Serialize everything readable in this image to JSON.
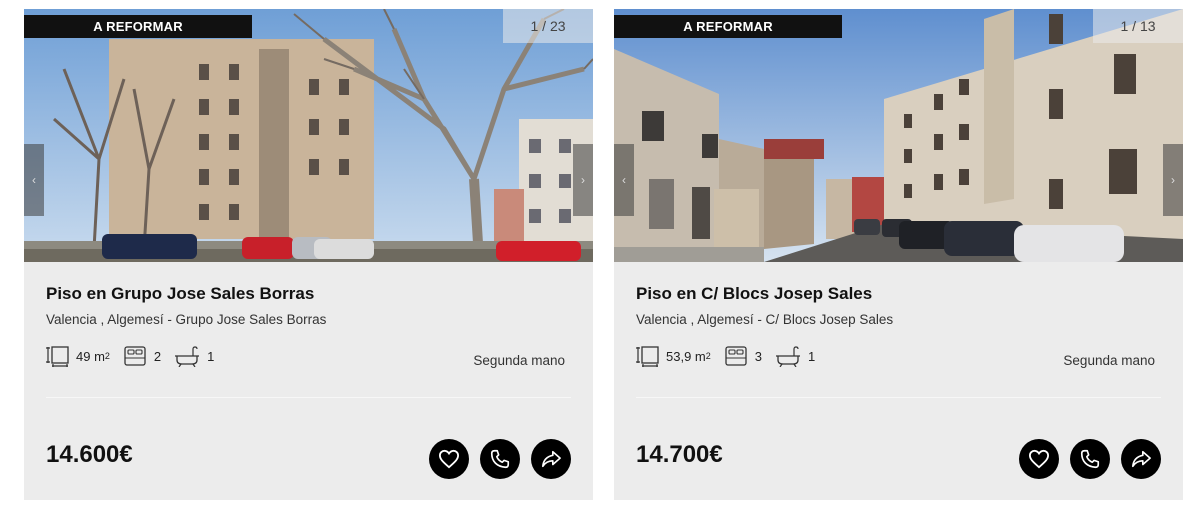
{
  "listings": [
    {
      "badge": "A REFORMAR",
      "photo_counter": "1 / 23",
      "title": "Piso en Grupo Jose Sales Borras",
      "location": "Valencia , Algemesí - Grupo Jose Sales Borras",
      "area_value": "49 m",
      "area_sup": "2",
      "bedrooms": "2",
      "bathrooms": "1",
      "condition": "Segunda mano",
      "price": "14.600€"
    },
    {
      "badge": "A REFORMAR",
      "photo_counter": "1 / 13",
      "title": "Piso en C/ Blocs Josep Sales",
      "location": "Valencia , Algemesí - C/ Blocs Josep Sales",
      "area_value": "53,9 m",
      "area_sup": "2",
      "bedrooms": "3",
      "bathrooms": "1",
      "condition": "Segunda mano",
      "price": "14.700€"
    }
  ],
  "icons": {
    "prev": "chevron-left-icon",
    "next": "chevron-right-icon",
    "area": "area-icon",
    "bed": "bed-icon",
    "bath": "bathtub-icon",
    "favorite": "heart-icon",
    "call": "phone-icon",
    "share": "share-icon"
  },
  "colors": {
    "card_bg": "#ececec",
    "badge_bg": "#111111",
    "button_bg": "#000000"
  }
}
